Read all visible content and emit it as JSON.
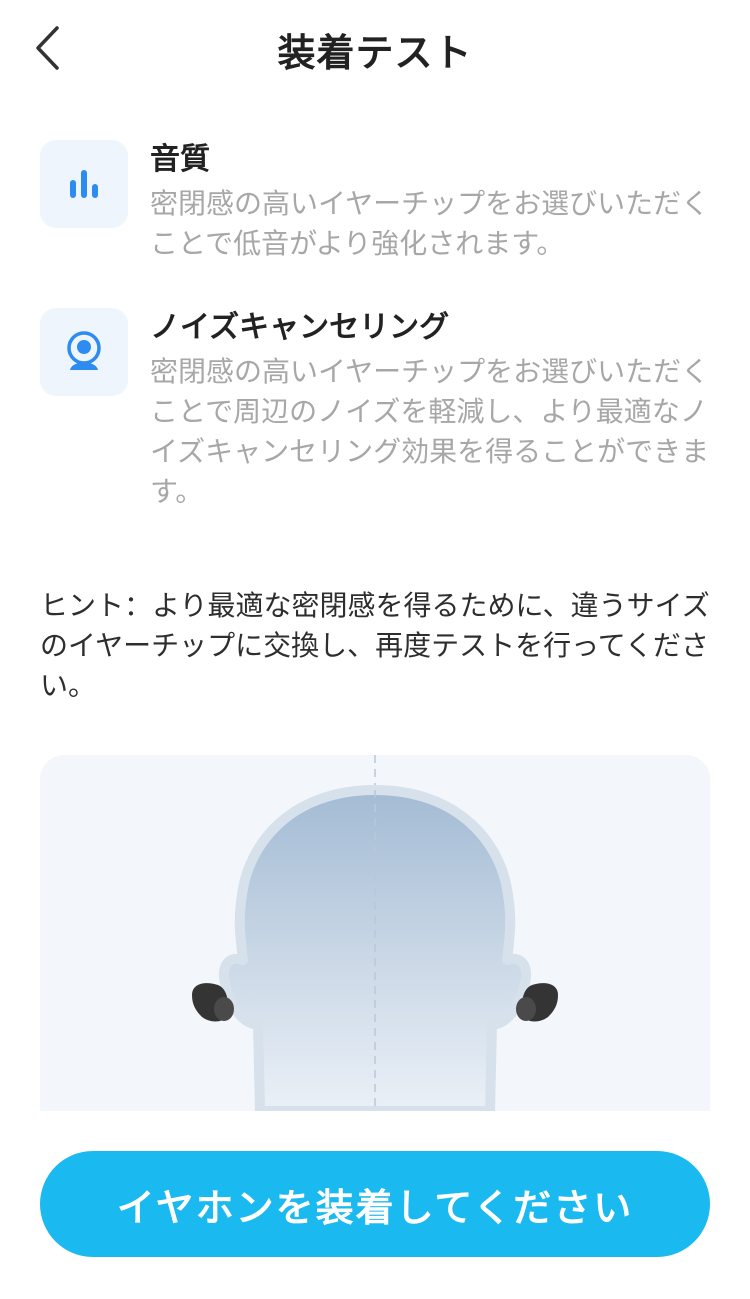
{
  "header": {
    "title": "装着テスト",
    "back_icon": "chevron-left-icon"
  },
  "features": [
    {
      "icon": "bar-chart-icon",
      "title": "音質",
      "description": "密閉感の高いイヤーチップをお選びいただくことで低音がより強化されます。"
    },
    {
      "icon": "person-in-circle-icon",
      "title": "ノイズキャンセリング",
      "description": "密閉感の高いイヤーチップをお選びいただくことで周辺のノイズを軽減し、より最適なノイズキャンセリング効果を得ることができます。"
    }
  ],
  "hint": "ヒント：より最適な密閉感を得るために、違うサイズのイヤーチップに交換し、再度テストを行ってください。",
  "illustration": {
    "name": "head-with-earbuds-illustration"
  },
  "cta": {
    "label": "イヤホンを装着してください"
  },
  "colors": {
    "accent": "#1ab9f0",
    "icon_blue": "#2d8cf0",
    "icon_bg": "#eef5fd",
    "muted_text": "#a7a7a7"
  }
}
